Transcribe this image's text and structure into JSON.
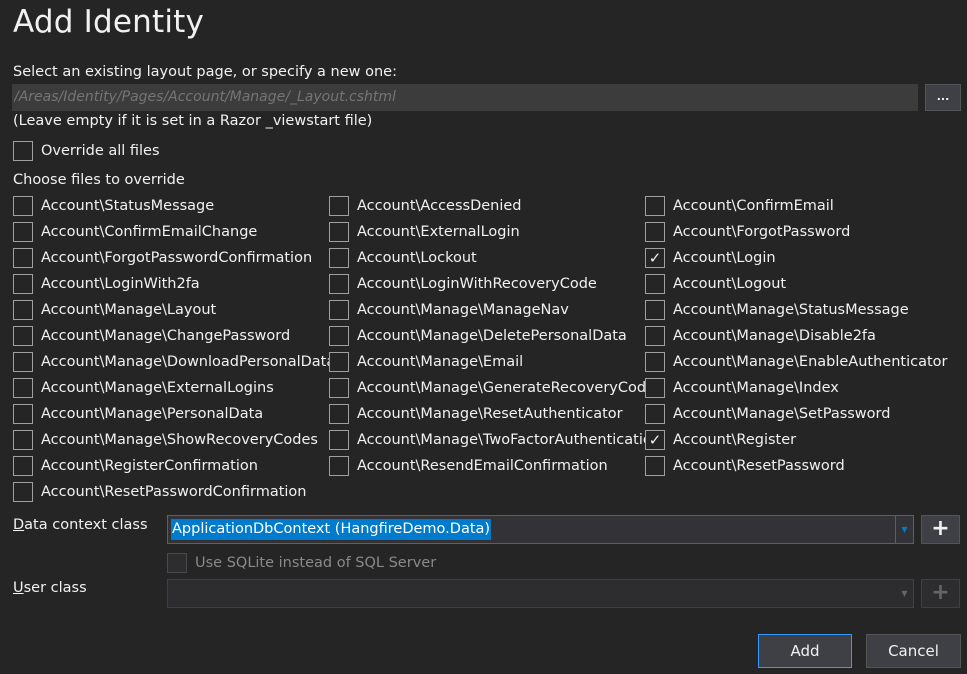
{
  "title": "Add Identity",
  "layout": {
    "label": "Select an existing layout page, or specify a new one:",
    "placeholder": "/Areas/Identity/Pages/Account/Manage/_Layout.cshtml",
    "browse_label": "...",
    "hint": "(Leave empty if it is set in a Razor _viewstart file)"
  },
  "override_all": {
    "label": "Override all files",
    "checked": false
  },
  "choose_label": "Choose files to override",
  "files": [
    [
      {
        "label": "Account\\StatusMessage",
        "checked": false
      },
      {
        "label": "Account\\ConfirmEmailChange",
        "checked": false
      },
      {
        "label": "Account\\ForgotPasswordConfirmation",
        "checked": false
      },
      {
        "label": "Account\\LoginWith2fa",
        "checked": false
      },
      {
        "label": "Account\\Manage\\Layout",
        "checked": false
      },
      {
        "label": "Account\\Manage\\ChangePassword",
        "checked": false
      },
      {
        "label": "Account\\Manage\\DownloadPersonalData",
        "checked": false
      },
      {
        "label": "Account\\Manage\\ExternalLogins",
        "checked": false
      },
      {
        "label": "Account\\Manage\\PersonalData",
        "checked": false
      },
      {
        "label": "Account\\Manage\\ShowRecoveryCodes",
        "checked": false
      },
      {
        "label": "Account\\RegisterConfirmation",
        "checked": false
      },
      {
        "label": "Account\\ResetPasswordConfirmation",
        "checked": false
      }
    ],
    [
      {
        "label": "Account\\AccessDenied",
        "checked": false
      },
      {
        "label": "Account\\ExternalLogin",
        "checked": false
      },
      {
        "label": "Account\\Lockout",
        "checked": false
      },
      {
        "label": "Account\\LoginWithRecoveryCode",
        "checked": false
      },
      {
        "label": "Account\\Manage\\ManageNav",
        "checked": false
      },
      {
        "label": "Account\\Manage\\DeletePersonalData",
        "checked": false
      },
      {
        "label": "Account\\Manage\\Email",
        "checked": false
      },
      {
        "label": "Account\\Manage\\GenerateRecoveryCodes",
        "checked": false
      },
      {
        "label": "Account\\Manage\\ResetAuthenticator",
        "checked": false
      },
      {
        "label": "Account\\Manage\\TwoFactorAuthentication",
        "checked": false
      },
      {
        "label": "Account\\ResendEmailConfirmation",
        "checked": false
      }
    ],
    [
      {
        "label": "Account\\ConfirmEmail",
        "checked": false
      },
      {
        "label": "Account\\ForgotPassword",
        "checked": false
      },
      {
        "label": "Account\\Login",
        "checked": true
      },
      {
        "label": "Account\\Logout",
        "checked": false
      },
      {
        "label": "Account\\Manage\\StatusMessage",
        "checked": false
      },
      {
        "label": "Account\\Manage\\Disable2fa",
        "checked": false
      },
      {
        "label": "Account\\Manage\\EnableAuthenticator",
        "checked": false
      },
      {
        "label": "Account\\Manage\\Index",
        "checked": false
      },
      {
        "label": "Account\\Manage\\SetPassword",
        "checked": false
      },
      {
        "label": "Account\\Register",
        "checked": true
      },
      {
        "label": "Account\\ResetPassword",
        "checked": false
      }
    ]
  ],
  "data_context": {
    "label": "Data context class",
    "value": "ApplicationDbContext (HangfireDemo.Data)",
    "add_label": "+"
  },
  "sqlite": {
    "label": "Use SQLite instead of SQL Server",
    "checked": false,
    "enabled": false
  },
  "user_class": {
    "label": "User class",
    "value": "",
    "add_label": "+"
  },
  "buttons": {
    "add": "Add",
    "cancel": "Cancel"
  },
  "check_glyph": "✓",
  "colors": {
    "background": "#252526",
    "accent": "#007acc",
    "input_bg": "#3c3c3c",
    "button_bg": "#3f3f46"
  }
}
